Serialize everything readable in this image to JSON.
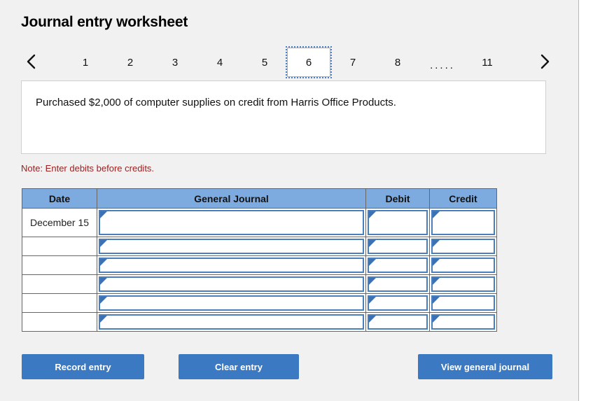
{
  "header": {
    "title": "Journal entry worksheet"
  },
  "pagination": {
    "prev_icon": "chevron-left-icon",
    "next_icon": "chevron-right-icon",
    "ellipsis": ".....",
    "active_page": "6",
    "pages": [
      "1",
      "2",
      "3",
      "4",
      "5",
      "6",
      "7",
      "8",
      "11"
    ]
  },
  "transaction": {
    "description": "Purchased $2,000 of computer supplies on credit from Harris Office Products."
  },
  "note": {
    "text": "Note: Enter debits before credits."
  },
  "journal": {
    "columns": [
      "Date",
      "General Journal",
      "Debit",
      "Credit"
    ],
    "rows": [
      {
        "date": "December 15",
        "general_journal": "",
        "debit": "",
        "credit": ""
      },
      {
        "date": "",
        "general_journal": "",
        "debit": "",
        "credit": ""
      },
      {
        "date": "",
        "general_journal": "",
        "debit": "",
        "credit": ""
      },
      {
        "date": "",
        "general_journal": "",
        "debit": "",
        "credit": ""
      },
      {
        "date": "",
        "general_journal": "",
        "debit": "",
        "credit": ""
      },
      {
        "date": "",
        "general_journal": "",
        "debit": "",
        "credit": ""
      }
    ]
  },
  "actions": {
    "record_entry": "Record entry",
    "clear_entry": "Clear entry",
    "view_general_journal": "View general journal"
  },
  "colors": {
    "page_background": "#f1f1f1",
    "table_header_blue": "#7dabe0",
    "button_blue": "#3b7ac2",
    "field_border_blue": "#4a7fbe",
    "note_red": "#9c2020",
    "selected_tab_outline": "#4a80c4"
  }
}
